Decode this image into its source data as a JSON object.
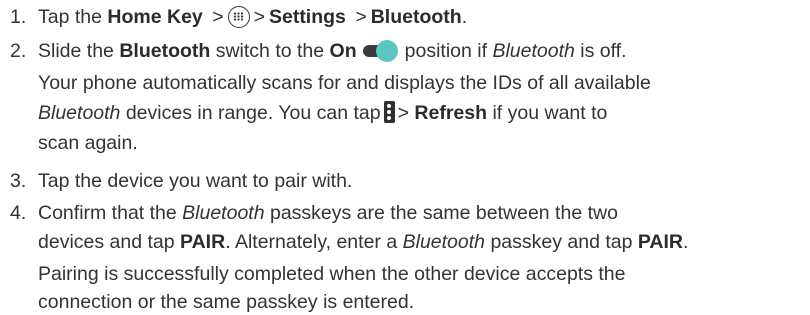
{
  "steps": [
    {
      "number": "1.",
      "text_tap": "Tap the",
      "home_key": "Home Key",
      "sep": ">",
      "apps_icon": "apps-grid-icon",
      "settings": "Settings",
      "bluetooth": "Bluetooth",
      "end": "."
    },
    {
      "number": "2.",
      "text_slide": "Slide the",
      "bluetooth": "Bluetooth",
      "text_switch_to": "switch to the",
      "on": "On",
      "toggle_icon": "toggle-switch-on-icon",
      "text_position": "position if",
      "bluetooth_italic": "Bluetooth",
      "text_off": "is off."
    },
    {
      "number": "3.",
      "text": "Tap the device you want to pair with."
    },
    {
      "number": "4.",
      "line1_a": "Confirm that the",
      "bluetooth_italic": "Bluetooth",
      "line1_b": "passkeys are the same between the two",
      "line2_a": "devices and tap",
      "pair": "PAIR",
      "line2_b": ". Alternately, enter a",
      "bluetooth_italic2": "Bluetooth",
      "line2_c": "passkey and tap",
      "pair2": "PAIR",
      "line2_end": "."
    }
  ],
  "note_scan": {
    "line1": "Your phone automatically scans for and displays the IDs of all available",
    "bluetooth_italic": "Bluetooth",
    "line2_a": "devices in range. You can tap",
    "menu_icon": "overflow-menu-icon",
    "sep": ">",
    "refresh": "Refresh",
    "line2_b": "if you want to",
    "line3": "scan again."
  },
  "note_pair": {
    "line1": "Pairing is successfully completed when the other device accepts the",
    "line2": "connection or the same passkey is entered."
  },
  "colors": {
    "text": "#333333",
    "toggle_knob": "#5cc6c0",
    "toggle_track": "#3b3b3b"
  }
}
